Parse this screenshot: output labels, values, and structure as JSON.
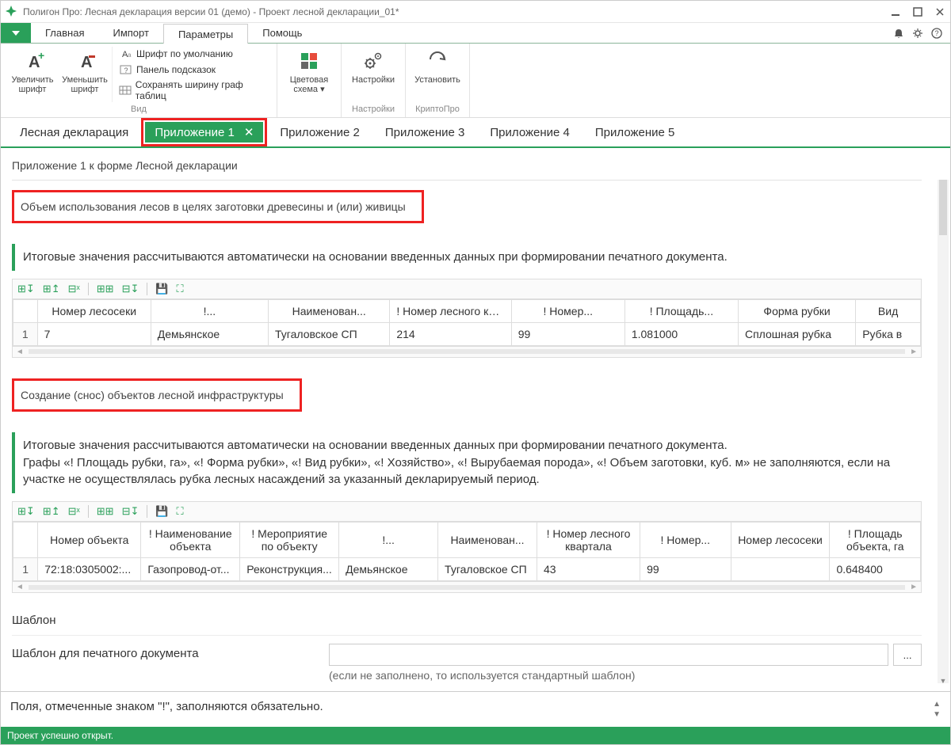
{
  "title": "Полигон Про: Лесная декларация версии 01 (демо) - Проект лесной декларации_01*",
  "menu": {
    "tabs": [
      "Главная",
      "Импорт",
      "Параметры",
      "Помощь"
    ]
  },
  "ribbon": {
    "font": {
      "inc": "Увеличить шрифт",
      "dec": "Уменьшить шрифт",
      "default": "Шрифт по умолчанию",
      "panel": "Панель подсказок",
      "savewidth": "Сохранять ширину граф таблиц",
      "group": "Вид"
    },
    "scheme": {
      "label": "Цветовая схема",
      "arrow": "▾"
    },
    "settings": {
      "label": "Настройки",
      "group": "Настройки"
    },
    "crypto": {
      "label": "Установить",
      "group": "КриптоПро"
    }
  },
  "doctabs": [
    "Лесная декларация",
    "Приложение 1",
    "Приложение 2",
    "Приложение 3",
    "Приложение 4",
    "Приложение 5"
  ],
  "content": {
    "subtitle": "Приложение 1 к форме Лесной декларации",
    "section1": {
      "title": "Объем использования лесов в целях заготовки древесины и (или) живицы",
      "info": "Итоговые значения рассчитываются автоматически на основании введенных данных при формировании печатного документа.",
      "headers": [
        "",
        "Номер лесосеки",
        "!...",
        "Наименован...",
        "! Номер лесного квартала",
        "! Номер...",
        "! Площадь...",
        "Форма рубки",
        "Вид"
      ],
      "row": [
        "1",
        "7",
        "Демьянское",
        "Тугаловское СП",
        "214",
        "99",
        "1.081000",
        "Сплошная рубка",
        "Рубка в"
      ]
    },
    "section2": {
      "title": "Создание (снос) объектов лесной инфраструктуры",
      "info": "Итоговые значения рассчитываются автоматически на основании введенных данных при формировании печатного документа.\nГрафы «! Площадь рубки, га», «! Форма рубки», «! Вид рубки», «! Хозяйство», «! Вырубаемая порода», «! Объем заготовки, куб. м» не заполняются, если на участке не осуществлялась рубка лесных насаждений за указанный декларируемый период.",
      "headers": [
        "",
        "Номер объекта",
        "! Наименование объекта",
        "! Мероприятие по объекту",
        "!...",
        "Наименован...",
        "! Номер лесного квартала",
        "! Номер...",
        "Номер лесосеки",
        "! Площадь объекта, га"
      ],
      "row": [
        "1",
        "72:18:0305002:...",
        "Газопровод-от...",
        "Реконструкция...",
        "Демьянское",
        "Тугаловское СП",
        "43",
        "99",
        "",
        "0.648400"
      ]
    },
    "template": {
      "heading": "Шаблон",
      "label": "Шаблон для печатного документа",
      "value": "",
      "hint": "(если не заполнено, то используется стандартный шаблон)"
    }
  },
  "footer": "Поля, отмеченные знаком \"!\", заполняются обязательно.",
  "status": "Проект успешно открыт."
}
